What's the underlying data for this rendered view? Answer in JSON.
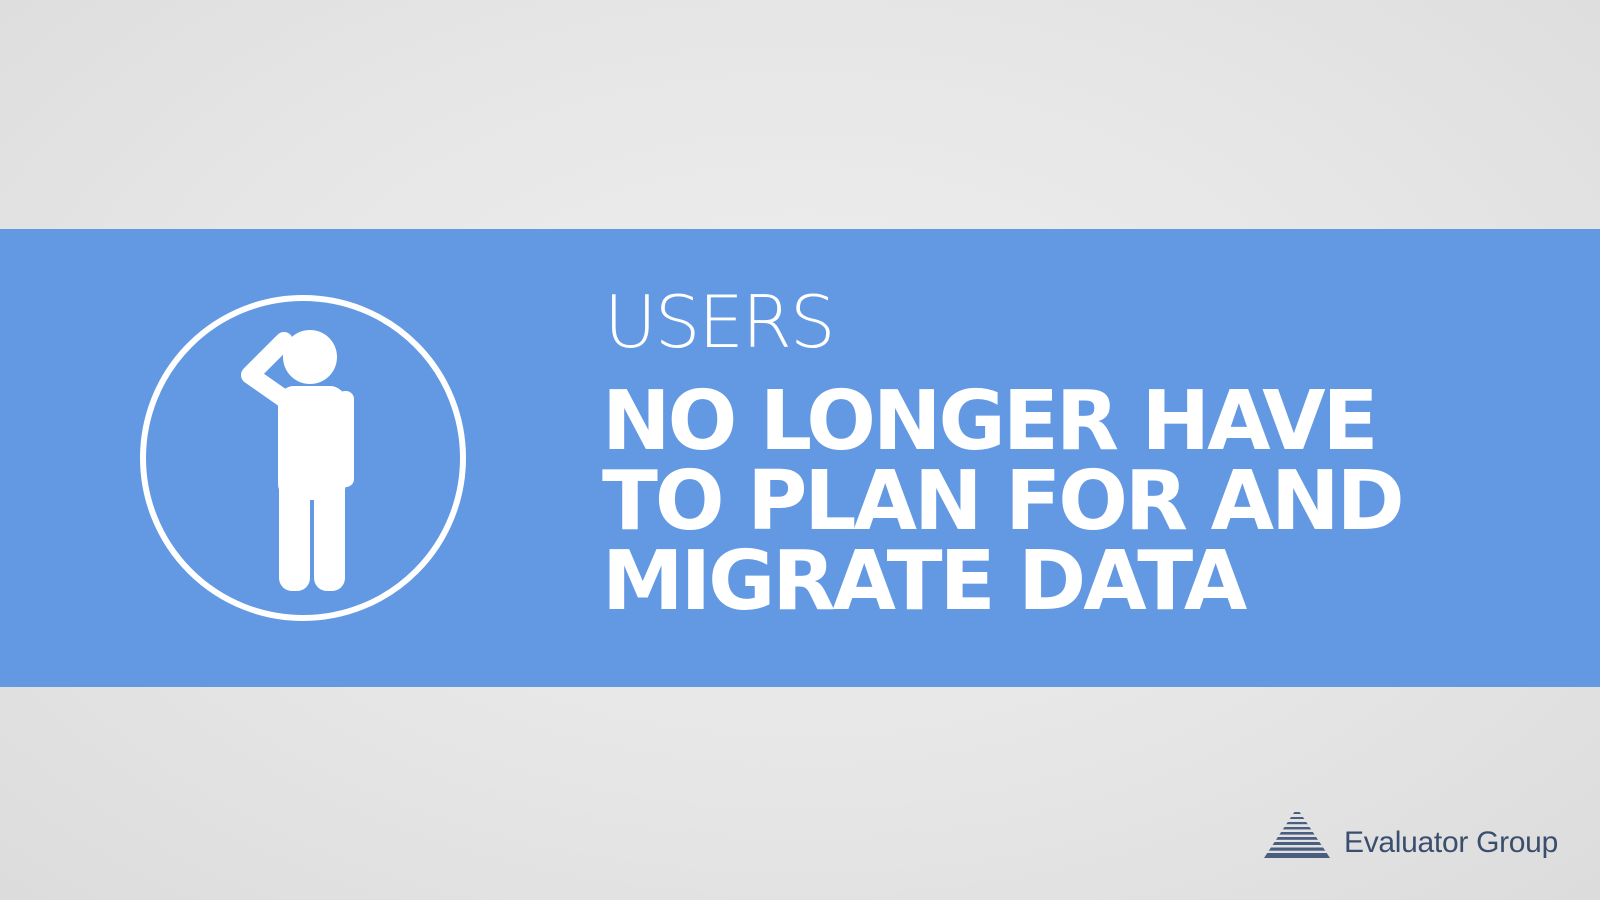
{
  "slide": {
    "subtitle": "USERS",
    "headline_lines": [
      "NO LONGER HAVE",
      "TO PLAN FOR AND",
      "MIGRATE DATA"
    ],
    "band_color": "#6399e3",
    "text_color": "#ffffff"
  },
  "icon": {
    "name": "person-scratching-head-icon"
  },
  "brand": {
    "name": "Evaluator Group",
    "logo": "pyramid-logo-icon",
    "color": "#3a4f6e"
  }
}
